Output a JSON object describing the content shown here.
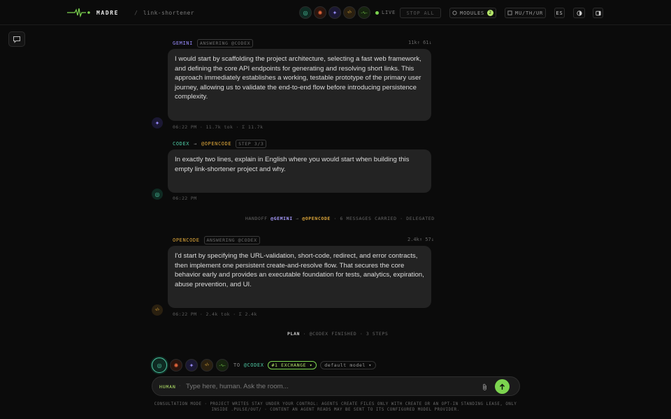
{
  "header": {
    "brand_name": "MADRE",
    "slash": "/",
    "project": "link-shortener",
    "agents": [
      {
        "name": "codex",
        "glyph": "◎",
        "color": "#4ec9a4",
        "bg": "#0f2a22"
      },
      {
        "name": "claude",
        "glyph": "✺",
        "color": "#e8673c",
        "bg": "#2a150e"
      },
      {
        "name": "gemini",
        "glyph": "✦",
        "color": "#9a8cff",
        "bg": "#1b1833"
      },
      {
        "name": "opencode",
        "glyph": "‹/›",
        "color": "#e0a83a",
        "bg": "#2a2010"
      },
      {
        "name": "pulse",
        "glyph": "-∿-",
        "color": "#7cd44f",
        "bg": "#16240f"
      }
    ],
    "live_label": "LIVE",
    "stop_all": "STOP ALL",
    "modules_label": "MODULES",
    "modules_count": "2",
    "layout_label": "MU/TH/UR",
    "lang": "ES"
  },
  "messages": [
    {
      "agent": "GEMINI",
      "pill": "ANSWERING @CODEX",
      "stats": "11k↑ 61↓",
      "text": "I would start by scaffolding the project architecture, selecting a fast web framework, and defining the core API endpoints for generating and resolving short links. This approach immediately establishes a working, testable prototype of the primary user journey, allowing us to validate the end-to-end flow before introducing persistence complexity.",
      "footer": "06:22 PM · 11.7k tok · Σ 11.7k"
    },
    {
      "agent": "CODEX",
      "arrow": "→",
      "target": "@OPENCODE",
      "pill": "STEP 3/3",
      "text": "In exactly two lines, explain in English where you would start when building this empty link-shortener project and why.",
      "footer": "06:22 PM"
    },
    {
      "agent": "OPENCODE",
      "pill": "ANSWERING @CODEX",
      "stats": "2.4k↑ 57↓",
      "text": "I'd start by specifying the URL-validation, short-code, redirect, and error contracts, then implement one persistent create-and-resolve flow. That secures the core behavior early and provides an executable foundation for tests, analytics, expiration, abuse prevention, and UI.",
      "footer": "06:22 PM · 2.4k tok · Σ 2.4k"
    }
  ],
  "handoff": {
    "prefix": "HANDOFF",
    "from": "@GEMINI",
    "arrow": "→",
    "to": "@OPENCODE",
    "rest": "· 6 MESSAGES CARRIED · DELEGATED"
  },
  "plan": {
    "label": "PLAN",
    "rest": "· @CODEX FINISHED · 3 STEPS"
  },
  "composer": {
    "to_label": "TO",
    "target": "@CODEX",
    "exchange": "#1 EXCHANGE ▾",
    "model": "default model ▾",
    "human": "HUMAN",
    "dot": "·",
    "placeholder": "Type here, human. Ask the room..."
  },
  "footer_note": "CONSULTATION MODE · PROJECT WRITES STAY UNDER YOUR CONTROL: AGENTS CREATE FILES ONLY WITH CREATE OR AN OPT-IN STANDING LEASE, ONLY INSIDE .PULSE/OUT/ · CONTENT AN AGENT READS MAY BE SENT TO ITS CONFIGURED MODEL PROVIDER."
}
